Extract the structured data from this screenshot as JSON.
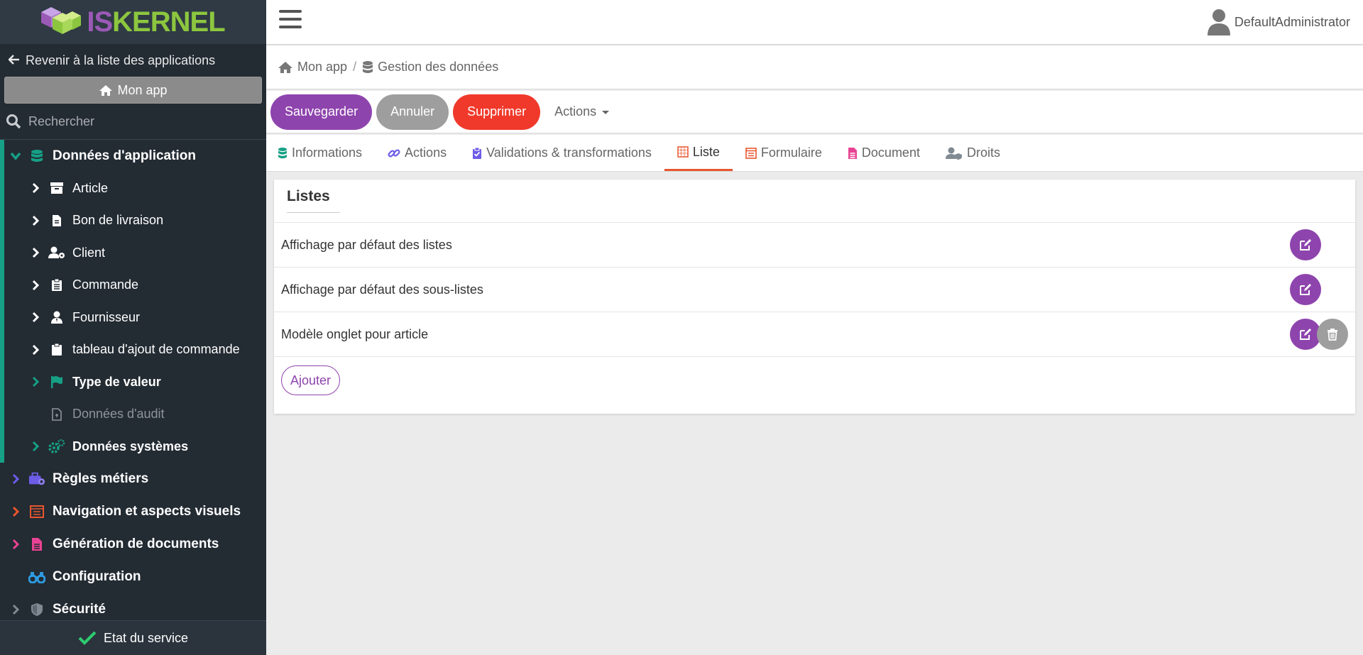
{
  "brand": {
    "logo_text": "ISKERNEL"
  },
  "sidebar": {
    "back_label": "Revenir à la liste des applications",
    "app_button_label": "Mon app",
    "search_placeholder": "Rechercher",
    "groups": [
      {
        "label": "Données d'application",
        "color": "#16a085"
      },
      {
        "label": "Règles métiers",
        "color": "#6c5ce7"
      },
      {
        "label": "Navigation et aspects visuels",
        "color": "#e8562e"
      },
      {
        "label": "Génération de documents",
        "color": "#e84393"
      },
      {
        "label": "Configuration",
        "color": "#2e9be0"
      },
      {
        "label": "Sécurité",
        "color": "#7f8a93"
      }
    ],
    "app_items": [
      {
        "label": "Article"
      },
      {
        "label": "Bon de livraison"
      },
      {
        "label": "Client"
      },
      {
        "label": "Commande"
      },
      {
        "label": "Fournisseur"
      },
      {
        "label": "tableau d'ajout de commande"
      },
      {
        "label": "Type de valeur"
      },
      {
        "label": "Données d'audit"
      },
      {
        "label": "Données systèmes"
      }
    ],
    "footer_label": "Etat du service"
  },
  "topbar": {
    "username": "DefaultAdministrator"
  },
  "breadcrumb": {
    "items": [
      "Mon app",
      "Gestion des données"
    ],
    "separator": "/"
  },
  "toolbar": {
    "save_label": "Sauvegarder",
    "cancel_label": "Annuler",
    "delete_label": "Supprimer",
    "actions_label": "Actions"
  },
  "tabs": [
    {
      "label": "Informations"
    },
    {
      "label": "Actions"
    },
    {
      "label": "Validations & transformations"
    },
    {
      "label": "Liste",
      "active": true
    },
    {
      "label": "Formulaire"
    },
    {
      "label": "Document"
    },
    {
      "label": "Droits"
    }
  ],
  "card": {
    "title": "Listes",
    "rows": [
      {
        "label": "Affichage par défaut des listes"
      },
      {
        "label": "Affichage par défaut des sous-listes"
      },
      {
        "label": "Modèle onglet pour article"
      }
    ],
    "add_label": "Ajouter"
  }
}
